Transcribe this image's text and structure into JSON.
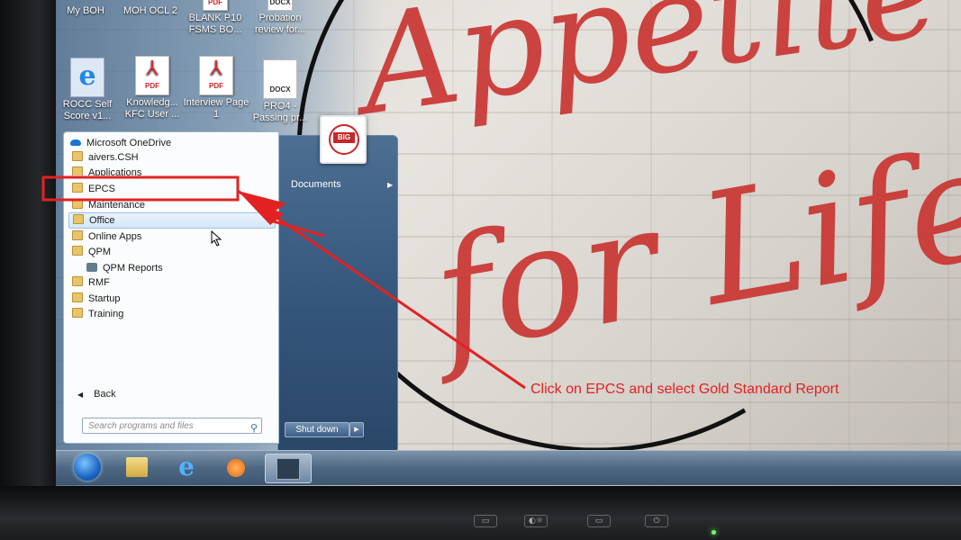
{
  "desktop": {
    "top_icons": [
      {
        "label": "My BOH"
      },
      {
        "label": "MOH OCL 2"
      },
      {
        "label": "BLANK P10 FSMS BO..."
      },
      {
        "label": "Probation review for..."
      }
    ],
    "icons": [
      {
        "label": "ROCC Self Score v1...",
        "type": "ie-icon"
      },
      {
        "label": "Knowledg... KFC User ...",
        "type": "pdf-icon",
        "tag": "PDF"
      },
      {
        "label": "Interview Page 1",
        "type": "pdf-icon",
        "tag": "PDF"
      },
      {
        "label": "PRO4 - Passing pr...",
        "type": "docx-icon",
        "tag": "DOCX"
      }
    ],
    "top_tags": {
      "pdf": "PDF",
      "docx": "DOCX"
    }
  },
  "wallpaper": {
    "text_line1": "Appetite",
    "text_line2": "for Life"
  },
  "start_menu": {
    "items": [
      {
        "label": "Microsoft OneDrive",
        "icon": "onedrive-icon"
      },
      {
        "label": "aivers.CSH",
        "icon": "folder-icon"
      },
      {
        "label": "Applications",
        "icon": "folder-icon"
      },
      {
        "label": "EPCS",
        "icon": "folder-icon"
      },
      {
        "label": "Maintenance",
        "icon": "folder-icon"
      },
      {
        "label": "Office",
        "icon": "folder-icon",
        "highlighted": true
      },
      {
        "label": "Online Apps",
        "icon": "folder-icon"
      },
      {
        "label": "QPM",
        "icon": "folder-icon"
      },
      {
        "label": "QPM Reports",
        "icon": "app-icon"
      },
      {
        "label": "RMF",
        "icon": "folder-icon"
      },
      {
        "label": "Startup",
        "icon": "folder-icon"
      },
      {
        "label": "Training",
        "icon": "folder-icon"
      }
    ],
    "back_label": "Back",
    "search_placeholder": "Search programs and files",
    "documents_label": "Documents",
    "shutdown_label": "Shut down",
    "user_badge": "BIG"
  },
  "taskbar": {
    "buttons": [
      "start-orb",
      "explorer-icon",
      "ie-icon",
      "media-player-icon",
      "remote-app-icon"
    ]
  },
  "annotation": {
    "text": "Click on EPCS and select Gold Standard Report",
    "color": "#e22222"
  },
  "monitor": {
    "buttons": [
      "menu-button",
      "brightness-button",
      "input-button",
      "power-button"
    ]
  }
}
